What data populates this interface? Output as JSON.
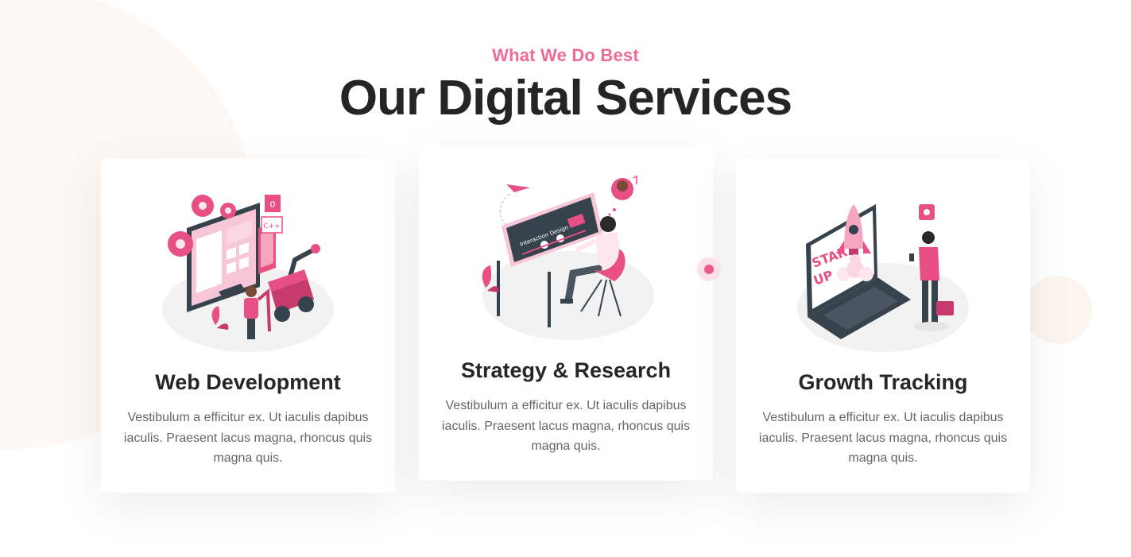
{
  "header": {
    "subtitle": "What We Do Best",
    "title": "Our Digital Services"
  },
  "colors": {
    "accent": "#ef6b97",
    "heading": "#252525",
    "body_text": "#666666"
  },
  "services": [
    {
      "title": "Web Development",
      "description": "Vestibulum a efficitur ex. Ut iaculis dapibus iaculis. Praesent lacus magna, rhoncus quis magna quis.",
      "illustration": "web-development-illustration",
      "illustration_labels": [
        "0",
        "C++"
      ]
    },
    {
      "title": "Strategy & Research",
      "description": "Vestibulum a efficitur ex. Ut iaculis dapibus iaculis. Praesent lacus magna, rhoncus quis magna quis.",
      "illustration": "interaction-design-illustration",
      "illustration_labels": [
        "Interaction Design"
      ]
    },
    {
      "title": "Growth Tracking",
      "description": "Vestibulum a efficitur ex. Ut iaculis dapibus iaculis. Praesent lacus magna, rhoncus quis magna quis.",
      "illustration": "startup-rocket-illustration",
      "illustration_labels": [
        "START",
        "UP"
      ]
    }
  ]
}
